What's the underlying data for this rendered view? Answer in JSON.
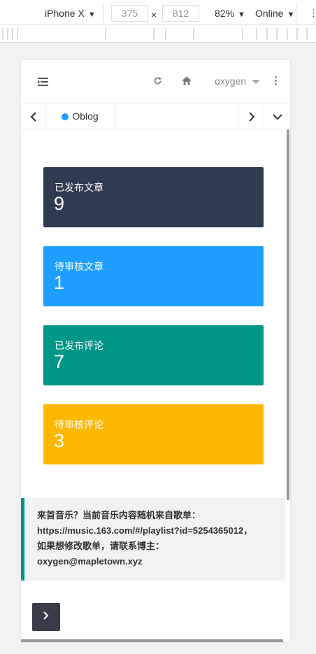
{
  "devtools": {
    "device": "iPhone X",
    "width": "375",
    "height": "812",
    "times": "×",
    "zoom": "82%",
    "network": "Online"
  },
  "header": {
    "user": "oxygen"
  },
  "tabs": {
    "active_tab": "Oblog"
  },
  "cards": [
    {
      "title": "已发布文章",
      "value": "9",
      "color": "#2f3b50"
    },
    {
      "title": "待审核文章",
      "value": "1",
      "color": "#1e9fff"
    },
    {
      "title": "已发布评论",
      "value": "7",
      "color": "#009688"
    },
    {
      "title": "待审核评论",
      "value": "3",
      "color": "#ffb800"
    }
  ],
  "notice": {
    "line1": "来首音乐？当前音乐内容随机来自歌单：",
    "line2": "https://music.163.com/#/playlist?id=5254365012，",
    "line3": "如果想修改歌单，请联系博主：",
    "line4": "oxygen@mapletown.xyz"
  }
}
